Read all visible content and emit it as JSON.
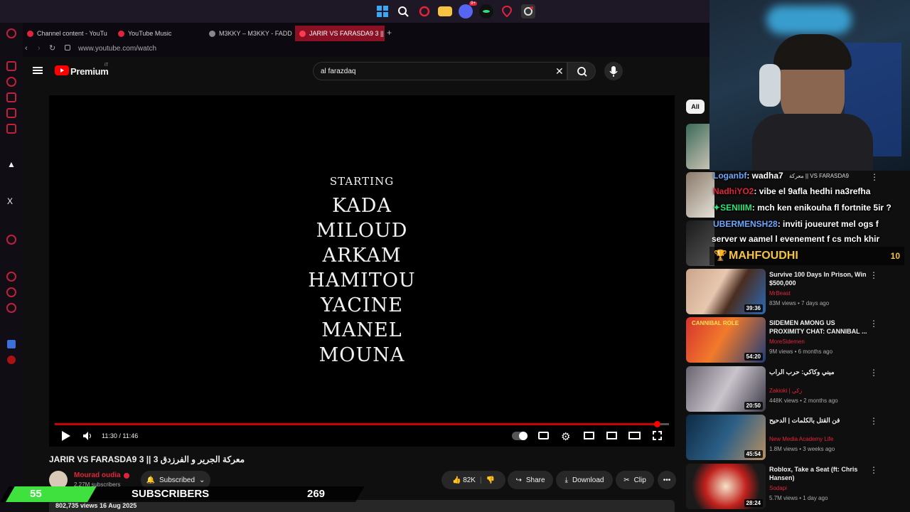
{
  "taskbar": {
    "discord_badge": "9+"
  },
  "tabs": [
    {
      "label": "Channel content - YouTu"
    },
    {
      "label": "YouTube Music"
    },
    {
      "label": "M3KKY – M3KKY - FADD"
    },
    {
      "label": "JARIR VS FARASDA9 3 ||"
    }
  ],
  "address": {
    "url": "www.youtube.com/watch"
  },
  "header": {
    "logo": "Premium",
    "country": "IT",
    "search_value": "al farazdaq",
    "chip_all": "All"
  },
  "video": {
    "credits_heading": "STARTING",
    "credits": [
      "KADA",
      "MILOUD",
      "ARKAM",
      "HAMITOU",
      "YACINE",
      "MANEL",
      "MOUNA"
    ],
    "time": "11:30 / 11:46",
    "progress": 0.98,
    "title": "JARIR VS FARASDA9 3 || معركة الجرير و الفرزدق 3",
    "channel": "Mourad oudia",
    "subscribers": "2.27M subscribers",
    "subscribed_label": "Subscribed",
    "likes": "82K",
    "share": "Share",
    "download": "Download",
    "clip": "Clip",
    "views_date": "802,735 views  16 Aug 2025"
  },
  "related": [
    {
      "title": "Survive 100 Days In Prison, Win $500,000",
      "channel": "MrBeast",
      "meta": "83M views • 7 days ago",
      "duration": "39:36"
    },
    {
      "title": "SIDEMEN AMONG US PROXIMITY CHAT: CANNIBAL ...",
      "channel": "MoreSidemen",
      "meta": "9M views • 6 months ago",
      "duration": "54:20"
    },
    {
      "title": "ميني وكاكي: حرب الراب",
      "channel": "Zakioki | زكي",
      "meta": "448K views • 2 months ago",
      "duration": "20:50"
    },
    {
      "title": "فن القتل بالكلمات | الدحيح",
      "channel": "New Media Academy Life",
      "meta": "1.8M views • 3 weeks ago",
      "duration": "45:54"
    },
    {
      "title": "Roblox, Take a Seat (ft: Chris Hansen)",
      "channel": "Sodapi",
      "meta": "5.7M views • 1 day ago",
      "duration": "28:24"
    }
  ],
  "partial_title": "معركة || VS FARASDA9",
  "chat": [
    {
      "user": "Loganbf",
      "msg": ": wadha7"
    },
    {
      "user": "NadhiYO2",
      "msg": ": vibe el 9afla hedhi na3refha"
    },
    {
      "user": "SENIIIM",
      "msg": ": mch ken enikouha fl fortnite 5ir ?"
    },
    {
      "user": "UBERMENSH28",
      "msg": ": inviti joueuret mel ogs f"
    },
    {
      "user": "",
      "msg": "server w aamel l evenement f cs mch khir"
    }
  ],
  "top_gifter": {
    "name": "MAHFOUDHI",
    "count": "10"
  },
  "subs": {
    "count": "55",
    "label": "SUBSCRIBERS",
    "goal": "269"
  },
  "colors": {
    "accent": "#e1243b",
    "progress": "#cc0000"
  }
}
